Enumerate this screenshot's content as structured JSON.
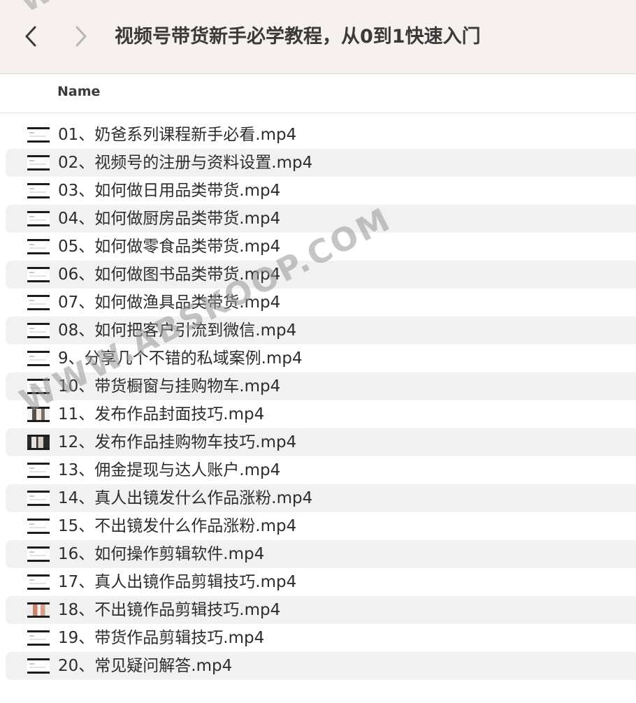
{
  "window": {
    "title": "视频号带货新手必学教程，从0到1快速入门"
  },
  "toolbar": {
    "back_icon": "chevron-left-icon",
    "forward_icon": "chevron-right-icon"
  },
  "columns": {
    "name_header": "Name"
  },
  "files": [
    {
      "name": "01、奶爸系列课程新手必看.mp4",
      "thumb": "plain"
    },
    {
      "name": "02、视频号的注册与资料设置.mp4",
      "thumb": "plain"
    },
    {
      "name": "03、如何做日用品类带货.mp4",
      "thumb": "plain"
    },
    {
      "name": "04、如何做厨房品类带货.mp4",
      "thumb": "plain"
    },
    {
      "name": "05、如何做零食品类带货.mp4",
      "thumb": "plain"
    },
    {
      "name": "06、如何做图书品类带货.mp4",
      "thumb": "plain"
    },
    {
      "name": "07、如何做渔具品类带货.mp4",
      "thumb": "plain"
    },
    {
      "name": "08、如何把客户引流到微信.mp4",
      "thumb": "plain"
    },
    {
      "name": "9、分享几个不错的私域案例.mp4",
      "thumb": "plain"
    },
    {
      "name": "10、带货橱窗与挂购物车.mp4",
      "thumb": "plain"
    },
    {
      "name": "11、发布作品封面技巧.mp4",
      "thumb": "face"
    },
    {
      "name": "12、发布作品挂购物车技巧.mp4",
      "thumb": "dark"
    },
    {
      "name": "13、佣金提现与达人账户.mp4",
      "thumb": "plain"
    },
    {
      "name": "14、真人出镜发什么作品涨粉.mp4",
      "thumb": "plain"
    },
    {
      "name": "15、不出镜发什么作品涨粉.mp4",
      "thumb": "plain"
    },
    {
      "name": "16、如何操作剪辑软件.mp4",
      "thumb": "plain"
    },
    {
      "name": "17、真人出镜作品剪辑技巧.mp4",
      "thumb": "plain"
    },
    {
      "name": "18、不出镜作品剪辑技巧.mp4",
      "thumb": "warm"
    },
    {
      "name": "19、带货作品剪辑技巧.mp4",
      "thumb": "plain"
    },
    {
      "name": "20、常见疑问解答.mp4",
      "thumb": "plain"
    }
  ],
  "watermark": {
    "text": "WWW.ABSKOOP.COM",
    "top_text": "WW"
  },
  "colors": {
    "titlebar_bg": "#f6f1ee",
    "row_alt_bg": "#f1f1f1",
    "text": "#2d2d2d"
  }
}
